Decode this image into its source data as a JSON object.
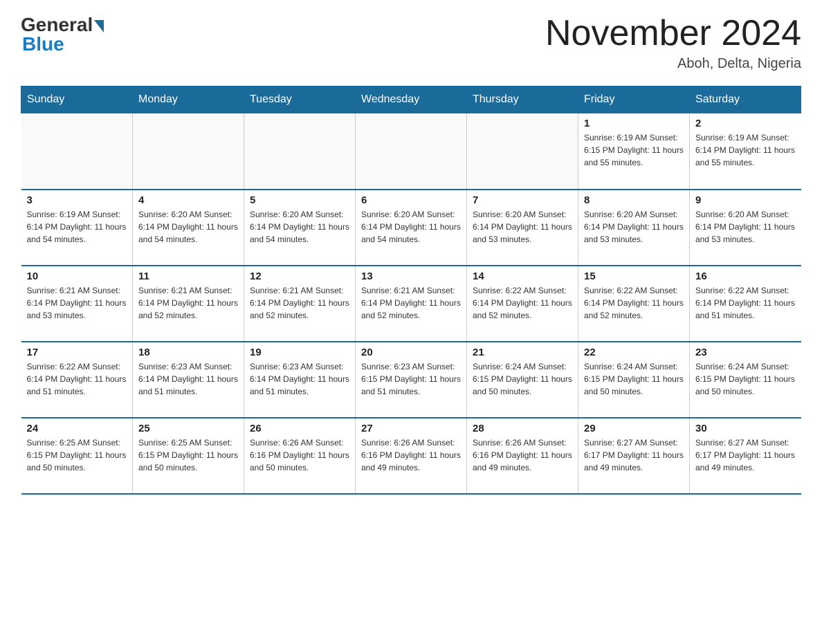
{
  "header": {
    "logo_general": "General",
    "logo_blue": "Blue",
    "month_title": "November 2024",
    "location": "Aboh, Delta, Nigeria"
  },
  "calendar": {
    "days_of_week": [
      "Sunday",
      "Monday",
      "Tuesday",
      "Wednesday",
      "Thursday",
      "Friday",
      "Saturday"
    ],
    "weeks": [
      [
        {
          "day": "",
          "info": ""
        },
        {
          "day": "",
          "info": ""
        },
        {
          "day": "",
          "info": ""
        },
        {
          "day": "",
          "info": ""
        },
        {
          "day": "",
          "info": ""
        },
        {
          "day": "1",
          "info": "Sunrise: 6:19 AM\nSunset: 6:15 PM\nDaylight: 11 hours and 55 minutes."
        },
        {
          "day": "2",
          "info": "Sunrise: 6:19 AM\nSunset: 6:14 PM\nDaylight: 11 hours and 55 minutes."
        }
      ],
      [
        {
          "day": "3",
          "info": "Sunrise: 6:19 AM\nSunset: 6:14 PM\nDaylight: 11 hours and 54 minutes."
        },
        {
          "day": "4",
          "info": "Sunrise: 6:20 AM\nSunset: 6:14 PM\nDaylight: 11 hours and 54 minutes."
        },
        {
          "day": "5",
          "info": "Sunrise: 6:20 AM\nSunset: 6:14 PM\nDaylight: 11 hours and 54 minutes."
        },
        {
          "day": "6",
          "info": "Sunrise: 6:20 AM\nSunset: 6:14 PM\nDaylight: 11 hours and 54 minutes."
        },
        {
          "day": "7",
          "info": "Sunrise: 6:20 AM\nSunset: 6:14 PM\nDaylight: 11 hours and 53 minutes."
        },
        {
          "day": "8",
          "info": "Sunrise: 6:20 AM\nSunset: 6:14 PM\nDaylight: 11 hours and 53 minutes."
        },
        {
          "day": "9",
          "info": "Sunrise: 6:20 AM\nSunset: 6:14 PM\nDaylight: 11 hours and 53 minutes."
        }
      ],
      [
        {
          "day": "10",
          "info": "Sunrise: 6:21 AM\nSunset: 6:14 PM\nDaylight: 11 hours and 53 minutes."
        },
        {
          "day": "11",
          "info": "Sunrise: 6:21 AM\nSunset: 6:14 PM\nDaylight: 11 hours and 52 minutes."
        },
        {
          "day": "12",
          "info": "Sunrise: 6:21 AM\nSunset: 6:14 PM\nDaylight: 11 hours and 52 minutes."
        },
        {
          "day": "13",
          "info": "Sunrise: 6:21 AM\nSunset: 6:14 PM\nDaylight: 11 hours and 52 minutes."
        },
        {
          "day": "14",
          "info": "Sunrise: 6:22 AM\nSunset: 6:14 PM\nDaylight: 11 hours and 52 minutes."
        },
        {
          "day": "15",
          "info": "Sunrise: 6:22 AM\nSunset: 6:14 PM\nDaylight: 11 hours and 52 minutes."
        },
        {
          "day": "16",
          "info": "Sunrise: 6:22 AM\nSunset: 6:14 PM\nDaylight: 11 hours and 51 minutes."
        }
      ],
      [
        {
          "day": "17",
          "info": "Sunrise: 6:22 AM\nSunset: 6:14 PM\nDaylight: 11 hours and 51 minutes."
        },
        {
          "day": "18",
          "info": "Sunrise: 6:23 AM\nSunset: 6:14 PM\nDaylight: 11 hours and 51 minutes."
        },
        {
          "day": "19",
          "info": "Sunrise: 6:23 AM\nSunset: 6:14 PM\nDaylight: 11 hours and 51 minutes."
        },
        {
          "day": "20",
          "info": "Sunrise: 6:23 AM\nSunset: 6:15 PM\nDaylight: 11 hours and 51 minutes."
        },
        {
          "day": "21",
          "info": "Sunrise: 6:24 AM\nSunset: 6:15 PM\nDaylight: 11 hours and 50 minutes."
        },
        {
          "day": "22",
          "info": "Sunrise: 6:24 AM\nSunset: 6:15 PM\nDaylight: 11 hours and 50 minutes."
        },
        {
          "day": "23",
          "info": "Sunrise: 6:24 AM\nSunset: 6:15 PM\nDaylight: 11 hours and 50 minutes."
        }
      ],
      [
        {
          "day": "24",
          "info": "Sunrise: 6:25 AM\nSunset: 6:15 PM\nDaylight: 11 hours and 50 minutes."
        },
        {
          "day": "25",
          "info": "Sunrise: 6:25 AM\nSunset: 6:15 PM\nDaylight: 11 hours and 50 minutes."
        },
        {
          "day": "26",
          "info": "Sunrise: 6:26 AM\nSunset: 6:16 PM\nDaylight: 11 hours and 50 minutes."
        },
        {
          "day": "27",
          "info": "Sunrise: 6:26 AM\nSunset: 6:16 PM\nDaylight: 11 hours and 49 minutes."
        },
        {
          "day": "28",
          "info": "Sunrise: 6:26 AM\nSunset: 6:16 PM\nDaylight: 11 hours and 49 minutes."
        },
        {
          "day": "29",
          "info": "Sunrise: 6:27 AM\nSunset: 6:17 PM\nDaylight: 11 hours and 49 minutes."
        },
        {
          "day": "30",
          "info": "Sunrise: 6:27 AM\nSunset: 6:17 PM\nDaylight: 11 hours and 49 minutes."
        }
      ]
    ]
  }
}
